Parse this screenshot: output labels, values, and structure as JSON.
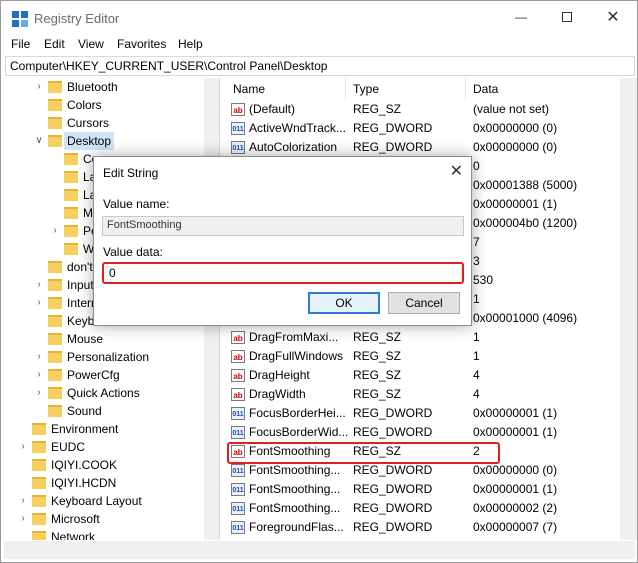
{
  "window": {
    "title": "Registry Editor"
  },
  "menu": [
    "File",
    "Edit",
    "View",
    "Favorites",
    "Help"
  ],
  "address": "Computer\\HKEY_CURRENT_USER\\Control Panel\\Desktop",
  "tree": [
    {
      "label": "Bluetooth",
      "indent": 1,
      "arrow": ">"
    },
    {
      "label": "Colors",
      "indent": 1,
      "arrow": ""
    },
    {
      "label": "Cursors",
      "indent": 1,
      "arrow": ""
    },
    {
      "label": "Desktop",
      "indent": 1,
      "arrow": "v",
      "selected": true
    },
    {
      "label": "Co",
      "indent": 2,
      "arrow": ""
    },
    {
      "label": "Lar",
      "indent": 2,
      "arrow": ""
    },
    {
      "label": "Lar",
      "indent": 2,
      "arrow": ""
    },
    {
      "label": "Mu",
      "indent": 2,
      "arrow": ""
    },
    {
      "label": "Per",
      "indent": 2,
      "arrow": ">"
    },
    {
      "label": "Wi",
      "indent": 2,
      "arrow": ""
    },
    {
      "label": "don't",
      "indent": 1,
      "arrow": ""
    },
    {
      "label": "Input",
      "indent": 1,
      "arrow": ">"
    },
    {
      "label": "Intern",
      "indent": 1,
      "arrow": ">"
    },
    {
      "label": "Keybo",
      "indent": 1,
      "arrow": ""
    },
    {
      "label": "Mouse",
      "indent": 1,
      "arrow": ""
    },
    {
      "label": "Personalization",
      "indent": 1,
      "arrow": ">"
    },
    {
      "label": "PowerCfg",
      "indent": 1,
      "arrow": ">"
    },
    {
      "label": "Quick Actions",
      "indent": 1,
      "arrow": ">"
    },
    {
      "label": "Sound",
      "indent": 1,
      "arrow": ""
    },
    {
      "label": "Environment",
      "indent": 0,
      "arrow": ""
    },
    {
      "label": "EUDC",
      "indent": 0,
      "arrow": ">"
    },
    {
      "label": "IQIYI.COOK",
      "indent": 0,
      "arrow": ""
    },
    {
      "label": "IQIYI.HCDN",
      "indent": 0,
      "arrow": ""
    },
    {
      "label": "Keyboard Layout",
      "indent": 0,
      "arrow": ">"
    },
    {
      "label": "Microsoft",
      "indent": 0,
      "arrow": ">"
    },
    {
      "label": "Network",
      "indent": 0,
      "arrow": ""
    }
  ],
  "columns": {
    "name": "Name",
    "type": "Type",
    "data": "Data"
  },
  "rows": [
    {
      "icon": "ab",
      "name": "(Default)",
      "type": "REG_SZ",
      "data": "(value not set)"
    },
    {
      "icon": "011",
      "name": "ActiveWndTrack...",
      "type": "REG_DWORD",
      "data": "0x00000000 (0)"
    },
    {
      "icon": "011",
      "name": "AutoColorization",
      "type": "REG_DWORD",
      "data": "0x00000000 (0)"
    },
    {
      "icon": "",
      "name": "",
      "type": "",
      "data": "0"
    },
    {
      "icon": "",
      "name": "",
      "type": "",
      "data": "0x00001388 (5000)"
    },
    {
      "icon": "",
      "name": "",
      "type": "",
      "data": "0x00000001 (1)"
    },
    {
      "icon": "",
      "name": "",
      "type": "",
      "data": "0x000004b0 (1200)"
    },
    {
      "icon": "",
      "name": "",
      "type": "",
      "data": "7"
    },
    {
      "icon": "",
      "name": "",
      "type": "",
      "data": "3"
    },
    {
      "icon": "",
      "name": "",
      "type": "",
      "data": "530"
    },
    {
      "icon": "",
      "name": "",
      "type": "",
      "data": "1"
    },
    {
      "icon": "",
      "name": "",
      "type": "",
      "data": "0x00001000 (4096)"
    },
    {
      "icon": "ab",
      "name": "DragFromMaxi...",
      "type": "REG_SZ",
      "data": "1"
    },
    {
      "icon": "ab",
      "name": "DragFullWindows",
      "type": "REG_SZ",
      "data": "1"
    },
    {
      "icon": "ab",
      "name": "DragHeight",
      "type": "REG_SZ",
      "data": "4"
    },
    {
      "icon": "ab",
      "name": "DragWidth",
      "type": "REG_SZ",
      "data": "4"
    },
    {
      "icon": "011",
      "name": "FocusBorderHei...",
      "type": "REG_DWORD",
      "data": "0x00000001 (1)"
    },
    {
      "icon": "011",
      "name": "FocusBorderWid...",
      "type": "REG_DWORD",
      "data": "0x00000001 (1)"
    },
    {
      "icon": "ab",
      "name": "FontSmoothing",
      "type": "REG_SZ",
      "data": "2"
    },
    {
      "icon": "011",
      "name": "FontSmoothing...",
      "type": "REG_DWORD",
      "data": "0x00000000 (0)"
    },
    {
      "icon": "011",
      "name": "FontSmoothing...",
      "type": "REG_DWORD",
      "data": "0x00000001 (1)"
    },
    {
      "icon": "011",
      "name": "FontSmoothing...",
      "type": "REG_DWORD",
      "data": "0x00000002 (2)"
    },
    {
      "icon": "011",
      "name": "ForegroundFlas...",
      "type": "REG_DWORD",
      "data": "0x00000007 (7)"
    }
  ],
  "dialog": {
    "title": "Edit String",
    "value_name_label": "Value name:",
    "value_name": "FontSmoothing",
    "value_data_label": "Value data:",
    "value_data": "0",
    "ok_label": "OK",
    "cancel_label": "Cancel"
  },
  "colors": {
    "highlight": "#e02020",
    "selection": "#cde5f7",
    "folder": "#f5cf5f"
  }
}
